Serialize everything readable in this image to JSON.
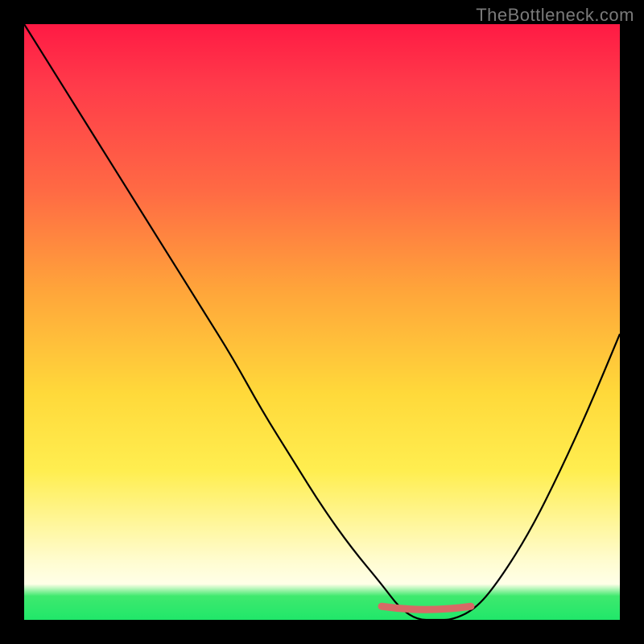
{
  "watermark": "TheBottleneck.com",
  "colors": {
    "frame": "#000000",
    "gradient_top": "#ff1a44",
    "gradient_mid": "#ffd93a",
    "gradient_low": "#fffccf",
    "gradient_bottom": "#20e76a",
    "curve": "#000000",
    "trough_highlight": "#d76a66"
  },
  "chart_data": {
    "type": "line",
    "title": "",
    "xlabel": "",
    "ylabel": "",
    "xlim": [
      0,
      100
    ],
    "ylim": [
      0,
      100
    ],
    "x": [
      0,
      5,
      10,
      15,
      20,
      25,
      30,
      35,
      40,
      45,
      50,
      55,
      60,
      63,
      66,
      69,
      72,
      76,
      80,
      85,
      90,
      95,
      100
    ],
    "values": [
      100,
      92,
      84,
      76,
      68,
      60,
      52,
      44,
      35,
      27,
      19,
      12,
      6,
      2,
      0,
      0,
      0,
      2,
      7,
      15,
      25,
      36,
      48
    ],
    "trough_segment": {
      "x_start": 60,
      "x_end": 75,
      "y": 2
    },
    "annotations": []
  }
}
